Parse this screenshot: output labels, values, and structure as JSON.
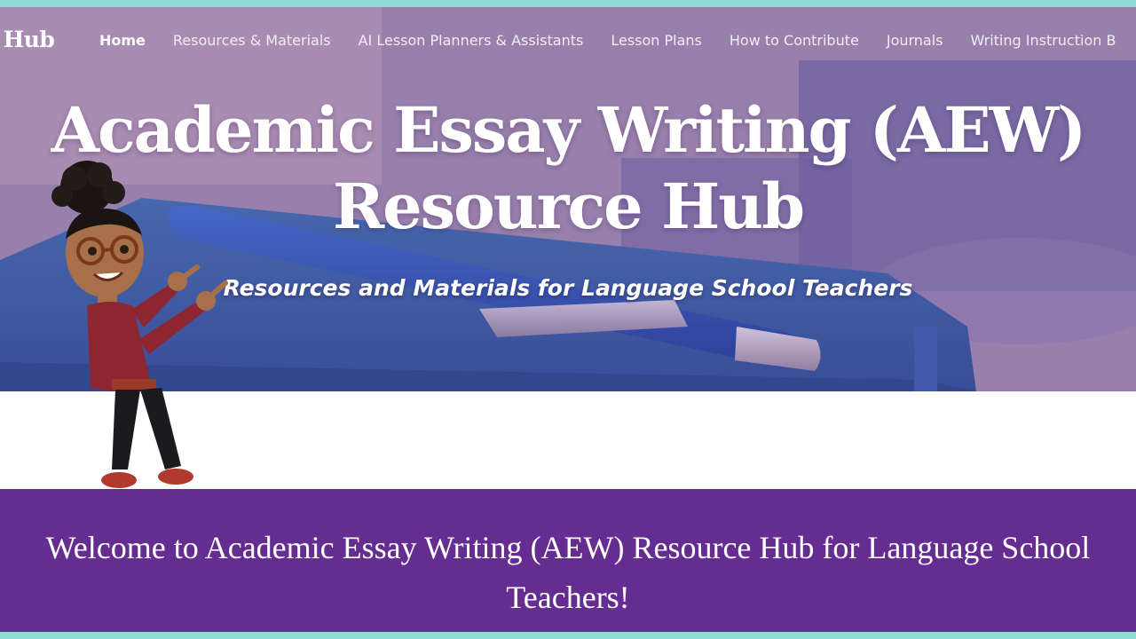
{
  "nav": {
    "brand": "e Hub",
    "links": [
      {
        "label": "Home",
        "active": true
      },
      {
        "label": "Resources & Materials",
        "active": false
      },
      {
        "label": "AI Lesson Planners & Assistants",
        "active": false
      },
      {
        "label": "Lesson Plans",
        "active": false
      },
      {
        "label": "How to Contribute",
        "active": false
      },
      {
        "label": "Journals",
        "active": false
      },
      {
        "label": "Writing Instruction B",
        "active": false
      }
    ]
  },
  "hero": {
    "title_line1": "Academic Essay Writing (AEW)",
    "title_line2": "Resource Hub",
    "subtitle": "Resources and Materials for Language School Teachers"
  },
  "welcome": {
    "line1": "Welcome to Academic Essay Writing (AEW) Resource Hub for Language School",
    "line2": "Teachers!"
  },
  "colors": {
    "frame_border": "#8fdad6",
    "welcome_band": "#652d91",
    "hero_tint": "#7d6aa6",
    "text_white": "#ffffff"
  },
  "icons": {
    "avatar": "teacher-avatar-pointing-icon"
  }
}
